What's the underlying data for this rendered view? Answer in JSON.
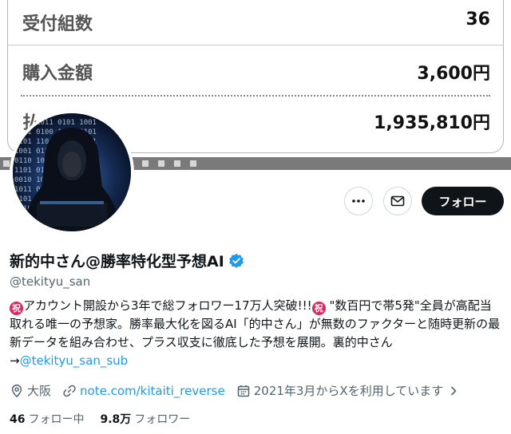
{
  "banner": {
    "rows": [
      {
        "label": "受付組数",
        "value": "36"
      },
      {
        "label": "購入金額",
        "value": "3,600円"
      },
      {
        "label": "払戻金額",
        "value": "1,935,810円"
      }
    ],
    "visible_label_3": "払"
  },
  "actions": {
    "more_icon": "more-icon",
    "message_icon": "envelope-icon",
    "follow_label": "フォロー"
  },
  "profile": {
    "display_name": "新的中さん@勝率特化型予想AI",
    "verified_icon": "verified-badge-icon",
    "handle": "@tekityu_san",
    "bio": {
      "badge": "祝",
      "part1": "アカウント開設から3年で総フォロワー17万人突破!!!",
      "part2": " \"数百円で帯5発\"全員が高配当取れる唯一の予想家。勝率最大化を図るAI「的中さん」が無数のファクターと随時更新の最新データを組み合わせ、プラス収支に徹底した予想を展開。裏的中さん→",
      "link": "@tekityu_san_sub"
    },
    "location": "大阪",
    "website": "note.com/kitaiti_reverse",
    "joined": "2021年3月からXを利用しています",
    "following_count": "46",
    "following_label": "フォロー中",
    "followers_count": "9.8万",
    "followers_label": "フォロワー"
  },
  "colors": {
    "accent": "#1d9bf0",
    "text": "#0f1419",
    "muted": "#536471",
    "badge": "#e0245e"
  }
}
